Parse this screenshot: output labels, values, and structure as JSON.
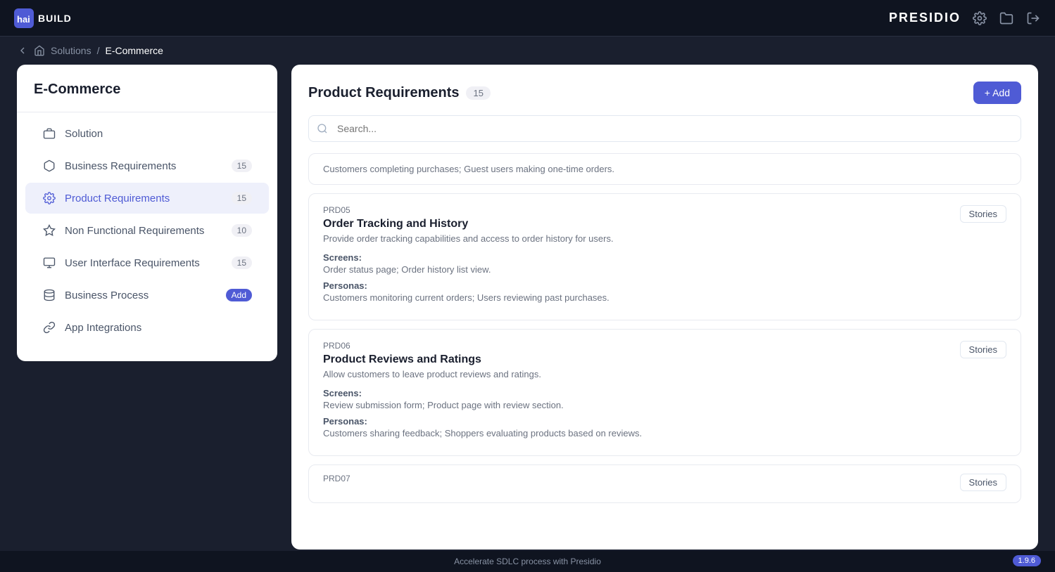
{
  "topnav": {
    "logo_text": "BUILD",
    "presidio": "PRESIDIO"
  },
  "breadcrumb": {
    "solutions_label": "Solutions",
    "separator": "/",
    "current": "E-Commerce"
  },
  "sidebar": {
    "title": "E-Commerce",
    "items": [
      {
        "id": "solution",
        "label": "Solution",
        "badge": null,
        "badge_type": "none",
        "active": false
      },
      {
        "id": "business-requirements",
        "label": "Business Requirements",
        "badge": "15",
        "badge_type": "count",
        "active": false
      },
      {
        "id": "product-requirements",
        "label": "Product Requirements",
        "badge": "15",
        "badge_type": "count",
        "active": true
      },
      {
        "id": "non-functional",
        "label": "Non Functional Requirements",
        "badge": "10",
        "badge_type": "count",
        "active": false
      },
      {
        "id": "user-interface",
        "label": "User Interface Requirements",
        "badge": "15",
        "badge_type": "count",
        "active": false
      },
      {
        "id": "business-process",
        "label": "Business Process",
        "badge": "Add",
        "badge_type": "add",
        "active": false
      },
      {
        "id": "app-integrations",
        "label": "App Integrations",
        "badge": null,
        "badge_type": "none",
        "active": false
      }
    ]
  },
  "content": {
    "title": "Product Requirements",
    "count": "15",
    "add_label": "+ Add",
    "search_placeholder": "Search...",
    "top_card": {
      "personas_text": "Customers completing purchases; Guest users making one-time orders."
    },
    "cards": [
      {
        "id": "PRD05",
        "title": "Order Tracking and History",
        "description": "Provide order tracking capabilities and access to order history for users.",
        "screens_label": "Screens:",
        "screens": "Order status page; Order history list view.",
        "personas_label": "Personas:",
        "personas": "Customers monitoring current orders; Users reviewing past purchases.",
        "stories_label": "Stories"
      },
      {
        "id": "PRD06",
        "title": "Product Reviews and Ratings",
        "description": "Allow customers to leave product reviews and ratings.",
        "screens_label": "Screens:",
        "screens": "Review submission form; Product page with review section.",
        "personas_label": "Personas:",
        "personas": "Customers sharing feedback; Shoppers evaluating products based on reviews.",
        "stories_label": "Stories"
      },
      {
        "id": "PRD07",
        "title": "",
        "description": "",
        "screens_label": "",
        "screens": "",
        "personas_label": "",
        "personas": "",
        "stories_label": "Stories"
      }
    ]
  },
  "footer": {
    "text": "Accelerate SDLC process with Presidio",
    "version": "1.9.6"
  }
}
